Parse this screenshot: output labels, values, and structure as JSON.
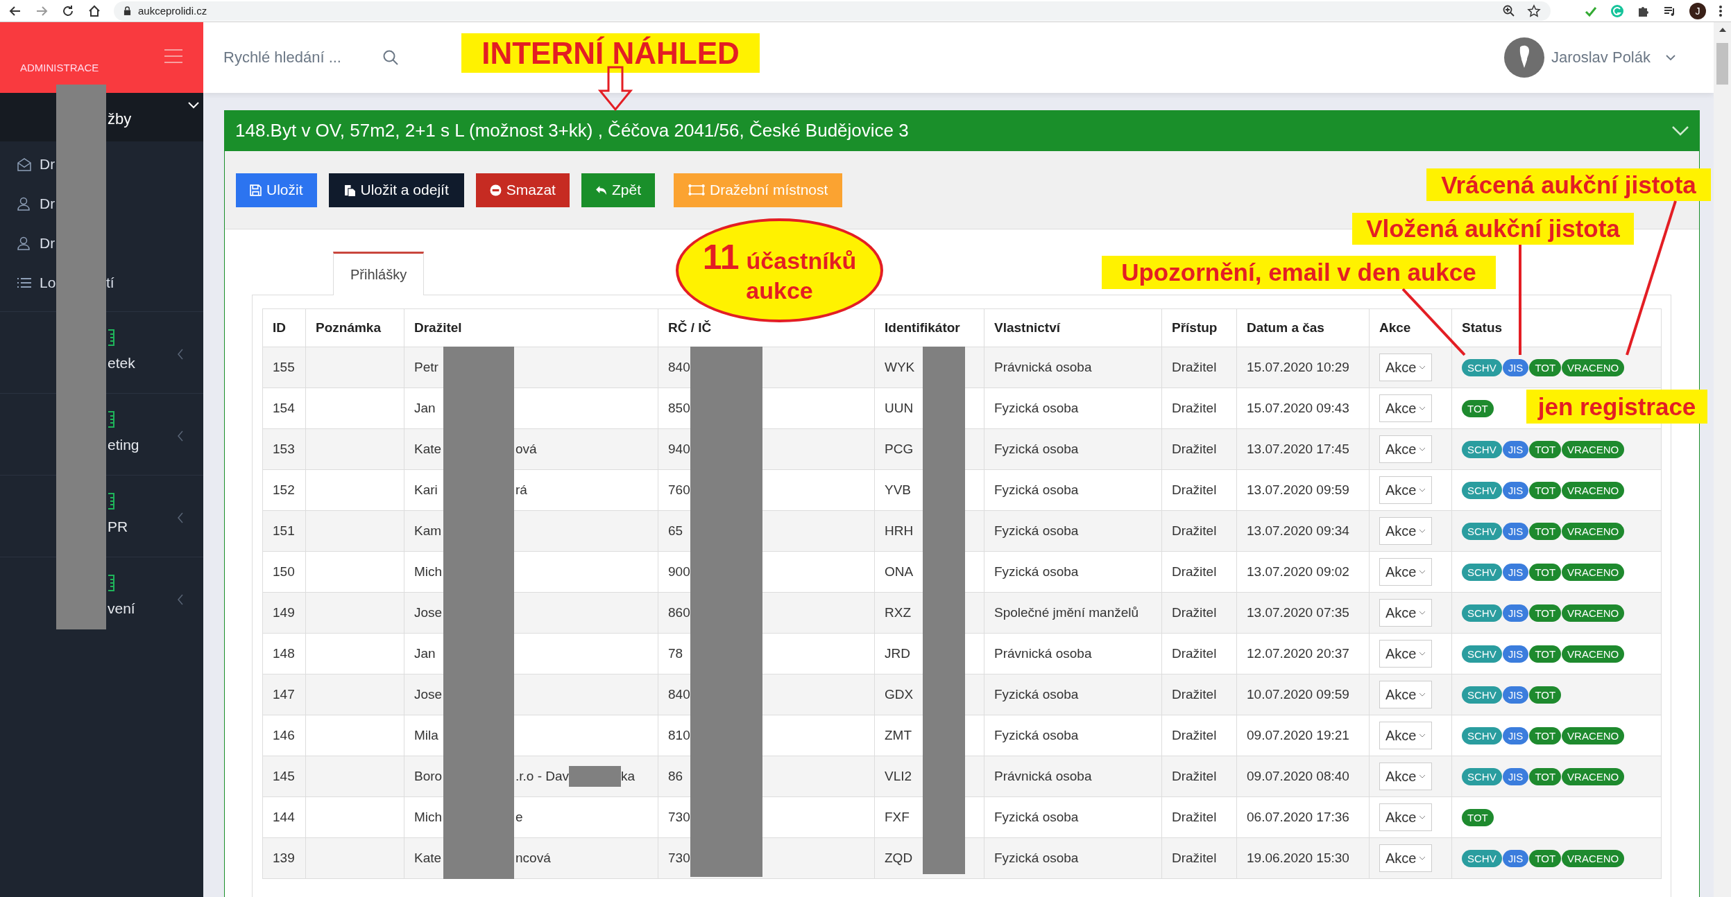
{
  "browser": {
    "url": "aukceprolidi.cz",
    "profile": "J"
  },
  "sidebar": {
    "brand": "ADMINISTRACE",
    "top_item": {
      "after": "žby",
      "expanded": true
    },
    "items": [
      {
        "before": "Dr"
      },
      {
        "before": "Dr"
      },
      {
        "before": "Dr"
      },
      {
        "before": "Lo",
        "after": "tí"
      }
    ],
    "sections": [
      {
        "after": "etek"
      },
      {
        "after": "eting"
      },
      {
        "after": "PR"
      },
      {
        "after": "vení"
      }
    ]
  },
  "header": {
    "search": {
      "placeholder": "Rychlé hledání ..."
    },
    "user": "Jaroslav Polák"
  },
  "panel": {
    "title": "148.Byt v OV, 57m2, 2+1 s L (možnost 3+kk) , Čéčova 2041/56, České Budějovice 3",
    "buttons": [
      {
        "label": "Uložit",
        "kind": "primary"
      },
      {
        "label": "Uložit a odejít",
        "kind": "dark"
      },
      {
        "label": "Smazat",
        "kind": "danger"
      },
      {
        "label": "Zpět",
        "kind": "success"
      },
      {
        "label": "Dražební místnost",
        "kind": "warning"
      }
    ]
  },
  "tabs": [
    {
      "label": "Přihlášky",
      "selected": true
    }
  ],
  "table": {
    "columns": [
      "ID",
      "Poznámka",
      "Dražitel",
      "RČ / IČ",
      "Identifikátor",
      "Vlastnictví",
      "Přístup",
      "Datum a čas",
      "Akce",
      "Status"
    ],
    "rows": [
      {
        "id": "155",
        "drazitel": [
          "Petr"
        ],
        "rc": "840",
        "ident": "WYK",
        "ownership": "Právnická osoba",
        "access": "Dražitel",
        "date": "15.07.2020 10:29",
        "action": "Akce",
        "status": [
          {
            "label": "SCHV",
            "kind": "schv"
          },
          {
            "label": "JIS",
            "kind": "jis"
          },
          {
            "label": "TOT",
            "kind": "tot"
          },
          {
            "label": "VRACENO",
            "kind": "vraceno"
          }
        ]
      },
      {
        "id": "154",
        "drazitel": [
          "Jan"
        ],
        "rc": "850",
        "ident": "UUN",
        "ownership": "Fyzická osoba",
        "access": "Dražitel",
        "date": "15.07.2020 09:43",
        "action": "Akce",
        "status": [
          {
            "label": "TOT",
            "kind": "tot"
          }
        ]
      },
      {
        "id": "153",
        "drazitel": [
          "Kate",
          "ová"
        ],
        "rc": "940",
        "ident": "PCG",
        "ownership": "Fyzická osoba",
        "access": "Dražitel",
        "date": "13.07.2020 17:45",
        "action": "Akce",
        "status": [
          {
            "label": "SCHV",
            "kind": "schv"
          },
          {
            "label": "JIS",
            "kind": "jis"
          },
          {
            "label": "TOT",
            "kind": "tot"
          },
          {
            "label": "VRACENO",
            "kind": "vraceno"
          }
        ]
      },
      {
        "id": "152",
        "drazitel": [
          "Kari",
          "rá"
        ],
        "rc": "760",
        "ident": "YVB",
        "ownership": "Fyzická osoba",
        "access": "Dražitel",
        "date": "13.07.2020 09:59",
        "action": "Akce",
        "status": [
          {
            "label": "SCHV",
            "kind": "schv"
          },
          {
            "label": "JIS",
            "kind": "jis"
          },
          {
            "label": "TOT",
            "kind": "tot"
          },
          {
            "label": "VRACENO",
            "kind": "vraceno"
          }
        ]
      },
      {
        "id": "151",
        "drazitel": [
          "Kam"
        ],
        "rc": "65",
        "ident": "HRH",
        "ownership": "Fyzická osoba",
        "access": "Dražitel",
        "date": "13.07.2020 09:34",
        "action": "Akce",
        "status": [
          {
            "label": "SCHV",
            "kind": "schv"
          },
          {
            "label": "JIS",
            "kind": "jis"
          },
          {
            "label": "TOT",
            "kind": "tot"
          },
          {
            "label": "VRACENO",
            "kind": "vraceno"
          }
        ]
      },
      {
        "id": "150",
        "drazitel": [
          "Mich"
        ],
        "rc": "900",
        "ident": "ONA",
        "ownership": "Fyzická osoba",
        "access": "Dražitel",
        "date": "13.07.2020 09:02",
        "action": "Akce",
        "status": [
          {
            "label": "SCHV",
            "kind": "schv"
          },
          {
            "label": "JIS",
            "kind": "jis"
          },
          {
            "label": "TOT",
            "kind": "tot"
          },
          {
            "label": "VRACENO",
            "kind": "vraceno"
          }
        ]
      },
      {
        "id": "149",
        "drazitel": [
          "Jose"
        ],
        "rc": "860",
        "ident": "RXZ",
        "ownership": "Společné jmění manželů",
        "access": "Dražitel",
        "date": "13.07.2020 07:35",
        "action": "Akce",
        "status": [
          {
            "label": "SCHV",
            "kind": "schv"
          },
          {
            "label": "JIS",
            "kind": "jis"
          },
          {
            "label": "TOT",
            "kind": "tot"
          },
          {
            "label": "VRACENO",
            "kind": "vraceno"
          }
        ]
      },
      {
        "id": "148",
        "drazitel": [
          "Jan"
        ],
        "rc": "78",
        "ident": "JRD",
        "ownership": "Právnická osoba",
        "access": "Dražitel",
        "date": "12.07.2020 20:37",
        "action": "Akce",
        "status": [
          {
            "label": "SCHV",
            "kind": "schv"
          },
          {
            "label": "JIS",
            "kind": "jis"
          },
          {
            "label": "TOT",
            "kind": "tot"
          },
          {
            "label": "VRACENO",
            "kind": "vraceno"
          }
        ]
      },
      {
        "id": "147",
        "drazitel": [
          "Jose"
        ],
        "rc": "840",
        "ident": "GDX",
        "ownership": "Fyzická osoba",
        "access": "Dražitel",
        "date": "10.07.2020 09:59",
        "action": "Akce",
        "status": [
          {
            "label": "SCHV",
            "kind": "schv"
          },
          {
            "label": "JIS",
            "kind": "jis"
          },
          {
            "label": "TOT",
            "kind": "tot"
          }
        ]
      },
      {
        "id": "146",
        "drazitel": [
          "Mila"
        ],
        "rc": "810",
        "ident": "ZMT",
        "ownership": "Fyzická osoba",
        "access": "Dražitel",
        "date": "09.07.2020 19:21",
        "action": "Akce",
        "status": [
          {
            "label": "SCHV",
            "kind": "schv"
          },
          {
            "label": "JIS",
            "kind": "jis"
          },
          {
            "label": "TOT",
            "kind": "tot"
          },
          {
            "label": "VRACENO",
            "kind": "vraceno"
          }
        ]
      },
      {
        "id": "145",
        "drazitel": [
          "Boro",
          ".r.o - Dav",
          "ka"
        ],
        "rc": "86",
        "ident": "VLI2",
        "ownership": "Právnická osoba",
        "access": "Dražitel",
        "date": "09.07.2020 08:40",
        "action": "Akce",
        "status": [
          {
            "label": "SCHV",
            "kind": "schv"
          },
          {
            "label": "JIS",
            "kind": "jis"
          },
          {
            "label": "TOT",
            "kind": "tot"
          },
          {
            "label": "VRACENO",
            "kind": "vraceno"
          }
        ]
      },
      {
        "id": "144",
        "drazitel": [
          "Mich",
          "e"
        ],
        "rc": "730",
        "ident": "FXF",
        "ownership": "Fyzická osoba",
        "access": "Dražitel",
        "date": "06.07.2020 17:36",
        "action": "Akce",
        "status": [
          {
            "label": "TOT",
            "kind": "tot"
          }
        ]
      },
      {
        "id": "139",
        "drazitel": [
          "Kate",
          "ncová"
        ],
        "rc": "730",
        "ident": "ZQD",
        "ownership": "Fyzická osoba",
        "access": "Dražitel",
        "date": "19.06.2020 15:30",
        "action": "Akce",
        "status": [
          {
            "label": "SCHV",
            "kind": "schv"
          },
          {
            "label": "JIS",
            "kind": "jis"
          },
          {
            "label": "TOT",
            "kind": "tot"
          },
          {
            "label": "VRACENO",
            "kind": "vraceno"
          }
        ]
      }
    ]
  },
  "annotations": {
    "title": "INTERNÍ NÁHLED",
    "count": "11",
    "count_label": "účastníků",
    "count_label2": "aukce",
    "notes": [
      {
        "text": "Vrácená aukční jistota",
        "kind": "returned"
      },
      {
        "text": "Vložená aukční jistota",
        "kind": "deposited"
      },
      {
        "text": "Upozornění, email v den aukce",
        "kind": "notice"
      },
      {
        "text": "jen registrace",
        "kind": "registration"
      }
    ]
  }
}
